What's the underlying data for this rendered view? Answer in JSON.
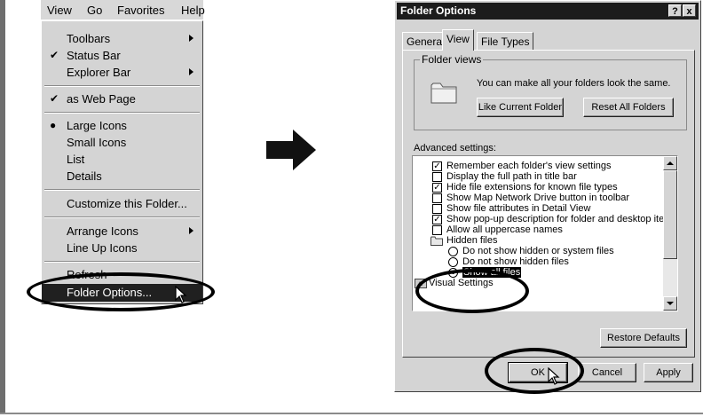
{
  "menubar": [
    "View",
    "Go",
    "Favorites",
    "Help"
  ],
  "view_menu": [
    {
      "label": "Toolbars",
      "submenu": true
    },
    {
      "label": "Status Bar",
      "check": true
    },
    {
      "label": "Explorer Bar",
      "submenu": true
    },
    {
      "label": "as Web Page",
      "check": true
    },
    {
      "label": "Large Icons",
      "bullet": true
    },
    {
      "label": "Small Icons"
    },
    {
      "label": "List"
    },
    {
      "label": "Details"
    },
    {
      "label": "Customize this Folder..."
    },
    {
      "label": "Arrange Icons",
      "submenu": true
    },
    {
      "label": "Line Up Icons"
    },
    {
      "label": "Refresh"
    },
    {
      "label": "Folder Options...",
      "highlighted": true
    }
  ],
  "dialog": {
    "title": "Folder Options",
    "title_buttons": [
      "?",
      "x"
    ],
    "tabs": [
      "General",
      "View",
      "File Types"
    ],
    "active_tab": "View",
    "folder_views": {
      "title": "Folder views",
      "description": "You can make all your folders look the same.",
      "like_current": "Like Current Folder",
      "reset_all": "Reset All Folders"
    },
    "advanced_label": "Advanced settings:",
    "advanced_items": [
      {
        "type": "checkbox",
        "checked": true,
        "label": "Remember each folder's view settings"
      },
      {
        "type": "checkbox",
        "checked": false,
        "label": "Display the full path in title bar"
      },
      {
        "type": "checkbox",
        "checked": true,
        "label": "Hide file extensions for known file types"
      },
      {
        "type": "checkbox",
        "checked": false,
        "label": "Show Map Network Drive button in toolbar"
      },
      {
        "type": "checkbox",
        "checked": false,
        "label": "Show file attributes in Detail View"
      },
      {
        "type": "checkbox",
        "checked": true,
        "label": "Show pop-up description for folder and desktop items."
      },
      {
        "type": "checkbox",
        "checked": false,
        "label": "Allow all uppercase names"
      },
      {
        "type": "folder",
        "label": "Hidden files"
      },
      {
        "type": "radio",
        "selected": false,
        "label": "Do not show hidden or system files"
      },
      {
        "type": "radio",
        "selected": false,
        "label": "Do not show hidden files"
      },
      {
        "type": "radio",
        "selected": true,
        "label": "Show all files"
      },
      {
        "type": "folder",
        "label": "Visual Settings"
      }
    ],
    "restore_defaults": "Restore Defaults",
    "ok": "OK",
    "cancel": "Cancel",
    "apply": "Apply"
  }
}
